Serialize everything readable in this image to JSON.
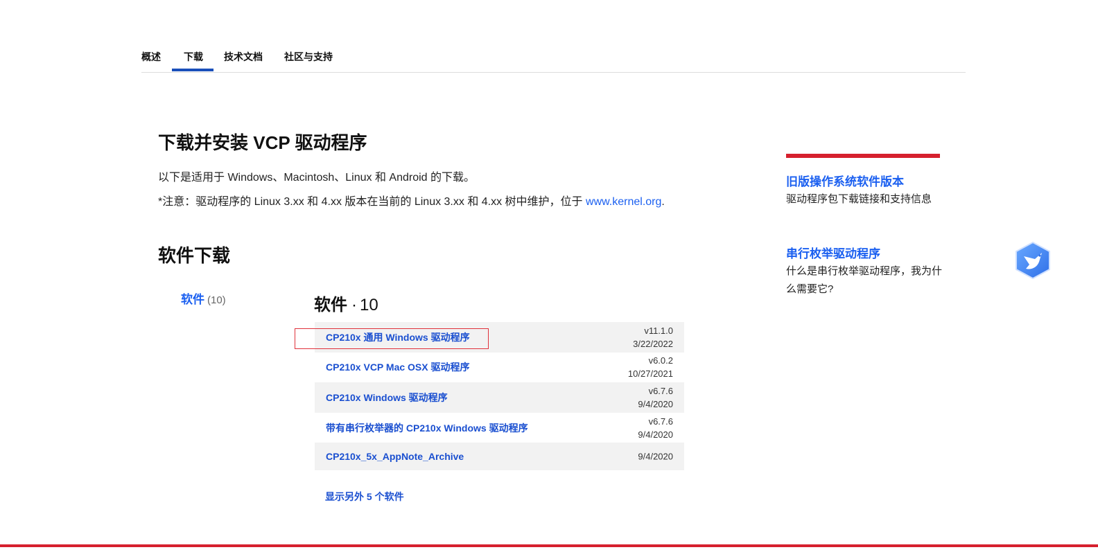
{
  "nav": {
    "tabs": [
      {
        "label": "概述"
      },
      {
        "label": "下载"
      },
      {
        "label": "技术文档"
      },
      {
        "label": "社区与支持"
      }
    ],
    "active_index": 1
  },
  "hero": {
    "title": "下载并安装 VCP 驱动程序",
    "intro": "以下是适用于 Windows、Macintosh、Linux 和 Android 的下载。",
    "note_prefix": "*注意：驱动程序的 Linux 3.xx 和 4.xx 版本在当前的 Linux 3.xx 和 4.xx 树中维护，位于 ",
    "note_link": "www.kernel.org",
    "note_suffix": "."
  },
  "downloads": {
    "section_title": "软件下载",
    "filter": {
      "label": "软件",
      "count": "(10)"
    },
    "list_heading": {
      "label": "软件",
      "dot": "·",
      "count": "10"
    },
    "items": [
      {
        "name": "CP210x 通用 Windows 驱动程序",
        "version": "v11.1.0",
        "date": "3/22/2022"
      },
      {
        "name": "CP210x VCP Mac OSX 驱动程序",
        "version": "v6.0.2",
        "date": "10/27/2021"
      },
      {
        "name": "CP210x Windows 驱动程序",
        "version": "v6.7.6",
        "date": "9/4/2020"
      },
      {
        "name": "带有串行枚举器的 CP210x Windows 驱动程序",
        "version": "v6.7.6",
        "date": "9/4/2020"
      },
      {
        "name": "CP210x_5x_AppNote_Archive",
        "version": "",
        "date": "9/4/2020"
      }
    ],
    "show_more": "显示另外 5 个软件"
  },
  "sidebar": {
    "links": [
      {
        "title": "旧版操作系统软件版本",
        "desc": "驱动程序包下载链接和支持信息"
      },
      {
        "title": "串行枚举驱动程序",
        "desc": "什么是串行枚举驱动程序，我为什么需要它?"
      }
    ]
  },
  "colors": {
    "accent_blue": "#1a5ff0",
    "tab_underline": "#1a4fba",
    "brand_red": "#d6202e",
    "row_shade": "#f2f2f2"
  },
  "icons": {
    "floating_assistant": "bird-hexagon-icon"
  }
}
